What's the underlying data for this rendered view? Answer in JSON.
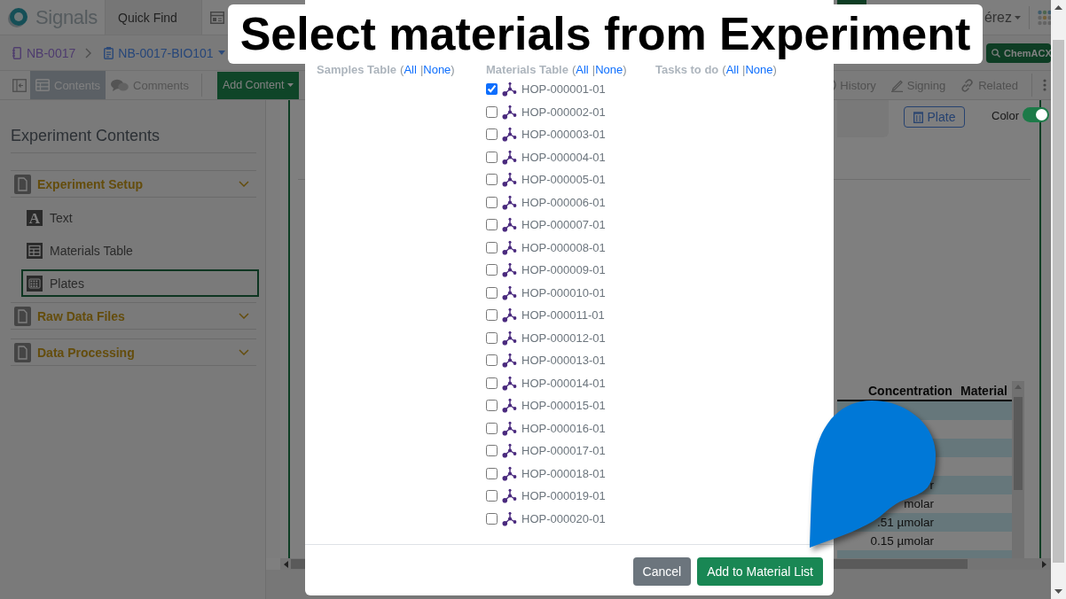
{
  "caption": {
    "title": "Select materials from Experiment"
  },
  "topbar": {
    "brand": "Signals",
    "quick_find": "Quick Find",
    "user": "érez"
  },
  "breadcrumb": {
    "items": [
      {
        "kind": "notebook",
        "label": "NB-0017"
      },
      {
        "kind": "experiment",
        "label": "NB-0017-BIO101"
      }
    ],
    "search_button": "ChemACX"
  },
  "toolbar": {
    "tabs": [
      {
        "kind": "contents",
        "label": "Contents",
        "selected": true
      },
      {
        "kind": "comments",
        "label": "Comments",
        "selected": false
      }
    ],
    "add_button": "Add Content",
    "actions": [
      {
        "kind": "history",
        "label": "History"
      },
      {
        "kind": "signing",
        "label": "Signing"
      },
      {
        "kind": "related",
        "label": "Related"
      }
    ]
  },
  "sidebar": {
    "title": "Experiment Contents",
    "sections": [
      {
        "label": "Experiment Setup",
        "children": [
          {
            "kind": "text",
            "icon": "A",
            "label": "Text",
            "selected": false
          },
          {
            "kind": "table",
            "label": "Materials Table",
            "selected": false
          },
          {
            "kind": "plate",
            "label": "Plates",
            "selected": true
          }
        ]
      },
      {
        "label": "Raw Data Files"
      },
      {
        "label": "Data Processing"
      }
    ]
  },
  "main": {
    "plate_button": "Plate",
    "color_toggle": {
      "label": "Color",
      "on": true
    },
    "table": {
      "columns": [
        "Concentration",
        "Material"
      ],
      "rows": [
        {
          "shaded": true
        },
        {
          "shaded": false
        },
        {
          "shaded": true
        },
        {
          "shaded": false
        },
        {
          "shaded": true,
          "concentration": "r"
        },
        {
          "shaded": false,
          "concentration": "molar"
        },
        {
          "shaded": true,
          "concentration": ".51 µmolar"
        },
        {
          "shaded": false,
          "concentration": "0.15 µmolar"
        },
        {
          "shaded": true
        }
      ]
    }
  },
  "modal": {
    "columns": [
      {
        "label": "Samples Table",
        "open_paren": "(",
        "all": "All",
        "separator": "|",
        "none": "None",
        "close_paren": ")"
      },
      {
        "label": "Materials Table",
        "open_paren": "(",
        "all": "All",
        "separator": "|",
        "none": "None",
        "close_paren": ")",
        "items": [
          {
            "label": "HOP-000001-01",
            "checked": true
          },
          {
            "label": "HOP-000002-01",
            "checked": false
          },
          {
            "label": "HOP-000003-01",
            "checked": false
          },
          {
            "label": "HOP-000004-01",
            "checked": false
          },
          {
            "label": "HOP-000005-01",
            "checked": false
          },
          {
            "label": "HOP-000006-01",
            "checked": false
          },
          {
            "label": "HOP-000007-01",
            "checked": false
          },
          {
            "label": "HOP-000008-01",
            "checked": false
          },
          {
            "label": "HOP-000009-01",
            "checked": false
          },
          {
            "label": "HOP-000010-01",
            "checked": false
          },
          {
            "label": "HOP-000011-01",
            "checked": false
          },
          {
            "label": "HOP-000012-01",
            "checked": false
          },
          {
            "label": "HOP-000013-01",
            "checked": false
          },
          {
            "label": "HOP-000014-01",
            "checked": false
          },
          {
            "label": "HOP-000015-01",
            "checked": false
          },
          {
            "label": "HOP-000016-01",
            "checked": false
          },
          {
            "label": "HOP-000017-01",
            "checked": false
          },
          {
            "label": "HOP-000018-01",
            "checked": false
          },
          {
            "label": "HOP-000019-01",
            "checked": false
          },
          {
            "label": "HOP-000020-01",
            "checked": false
          }
        ]
      },
      {
        "label": "Tasks to do",
        "open_paren": "(",
        "all": "All",
        "separator": "|",
        "none": "None",
        "close_paren": ")"
      }
    ],
    "buttons": [
      {
        "kind": "secondary",
        "label": "Cancel"
      },
      {
        "kind": "primary",
        "label": "Add to Material List"
      }
    ]
  }
}
